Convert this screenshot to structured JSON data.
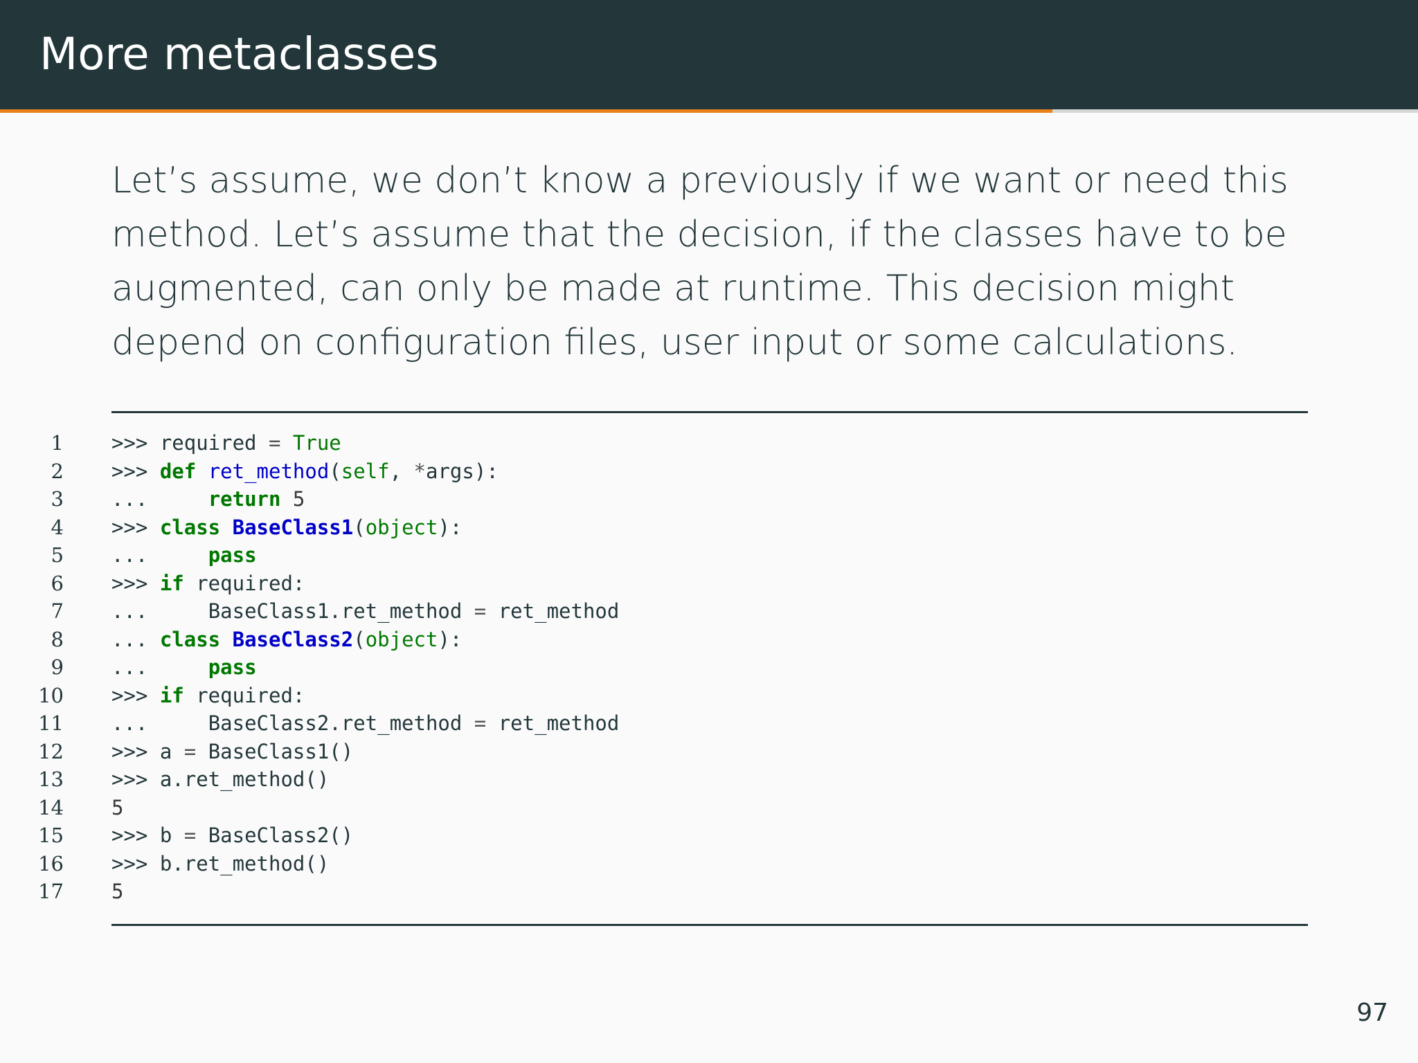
{
  "slide": {
    "title": "More metaclasses",
    "progress": 0.742,
    "paragraph_lines": [
      "Let’s assume, we don’t know a previously if we want or need this",
      "method.  Let’s assume that the decision, if the classes have to be",
      "augmented, can only be made at runtime.  This decision might",
      "depend on configuration files, user input or some calculations."
    ],
    "page_number": "97"
  },
  "code": {
    "lines": [
      {
        "no": "1",
        "tokens": [
          [
            "prompt",
            ">>> "
          ],
          [
            "text",
            "required "
          ],
          [
            "op",
            "="
          ],
          [
            "text",
            " "
          ],
          [
            "builtin",
            "True"
          ]
        ]
      },
      {
        "no": "2",
        "tokens": [
          [
            "prompt",
            ">>> "
          ],
          [
            "kw",
            "def"
          ],
          [
            "text",
            " "
          ],
          [
            "name",
            "ret_method"
          ],
          [
            "text",
            "("
          ],
          [
            "builtin",
            "self"
          ],
          [
            "text",
            ", "
          ],
          [
            "op",
            "*"
          ],
          [
            "text",
            "args):"
          ]
        ]
      },
      {
        "no": "3",
        "tokens": [
          [
            "prompt",
            "...     "
          ],
          [
            "kw",
            "return"
          ],
          [
            "text",
            " "
          ],
          [
            "num",
            "5"
          ]
        ]
      },
      {
        "no": "4",
        "tokens": [
          [
            "prompt",
            ">>> "
          ],
          [
            "kw",
            "class"
          ],
          [
            "text",
            " "
          ],
          [
            "class",
            "BaseClass1"
          ],
          [
            "text",
            "("
          ],
          [
            "builtin",
            "object"
          ],
          [
            "text",
            "):"
          ]
        ]
      },
      {
        "no": "5",
        "tokens": [
          [
            "prompt",
            "...     "
          ],
          [
            "kw",
            "pass"
          ]
        ]
      },
      {
        "no": "6",
        "tokens": [
          [
            "prompt",
            ">>> "
          ],
          [
            "kw",
            "if"
          ],
          [
            "text",
            " required:"
          ]
        ]
      },
      {
        "no": "7",
        "tokens": [
          [
            "prompt",
            "...     "
          ],
          [
            "text",
            "BaseClass1.ret_method "
          ],
          [
            "op",
            "="
          ],
          [
            "text",
            " ret_method"
          ]
        ]
      },
      {
        "no": "8",
        "tokens": [
          [
            "prompt",
            "... "
          ],
          [
            "kw",
            "class"
          ],
          [
            "text",
            " "
          ],
          [
            "class",
            "BaseClass2"
          ],
          [
            "text",
            "("
          ],
          [
            "builtin",
            "object"
          ],
          [
            "text",
            "):"
          ]
        ]
      },
      {
        "no": "9",
        "tokens": [
          [
            "prompt",
            "...     "
          ],
          [
            "kw",
            "pass"
          ]
        ]
      },
      {
        "no": "10",
        "tokens": [
          [
            "prompt",
            ">>> "
          ],
          [
            "kw",
            "if"
          ],
          [
            "text",
            " required:"
          ]
        ]
      },
      {
        "no": "11",
        "tokens": [
          [
            "prompt",
            "...     "
          ],
          [
            "text",
            "BaseClass2.ret_method "
          ],
          [
            "op",
            "="
          ],
          [
            "text",
            " ret_method"
          ]
        ]
      },
      {
        "no": "12",
        "tokens": [
          [
            "prompt",
            ">>> "
          ],
          [
            "text",
            "a "
          ],
          [
            "op",
            "="
          ],
          [
            "text",
            " BaseClass1()"
          ]
        ]
      },
      {
        "no": "13",
        "tokens": [
          [
            "prompt",
            ">>> "
          ],
          [
            "text",
            "a.ret_method()"
          ]
        ]
      },
      {
        "no": "14",
        "tokens": [
          [
            "num",
            "5"
          ]
        ]
      },
      {
        "no": "15",
        "tokens": [
          [
            "prompt",
            ">>> "
          ],
          [
            "text",
            "b "
          ],
          [
            "op",
            "="
          ],
          [
            "text",
            " BaseClass2()"
          ]
        ]
      },
      {
        "no": "16",
        "tokens": [
          [
            "prompt",
            ">>> "
          ],
          [
            "text",
            "b.ret_method()"
          ]
        ]
      },
      {
        "no": "17",
        "tokens": [
          [
            "num",
            "5"
          ]
        ]
      }
    ]
  }
}
